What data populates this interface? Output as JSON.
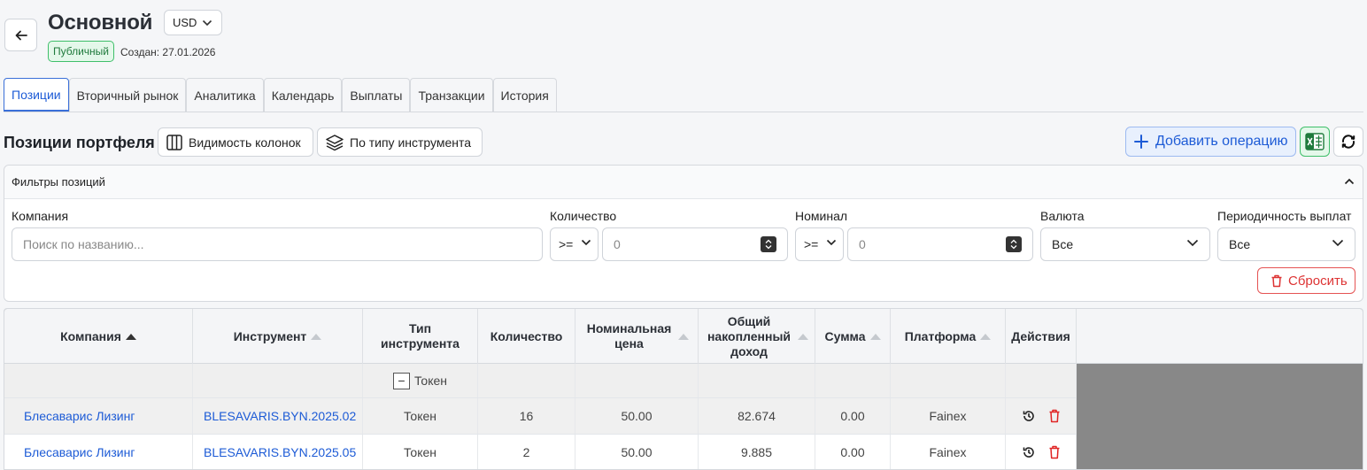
{
  "header": {
    "title": "Основной",
    "currency": "USD",
    "badge": "Публичный",
    "created": "Создан: 27.01.2026"
  },
  "tabs": [
    {
      "label": "Позиции",
      "active": true
    },
    {
      "label": "Вторичный рынок"
    },
    {
      "label": "Аналитика"
    },
    {
      "label": "Календарь"
    },
    {
      "label": "Выплаты"
    },
    {
      "label": "Транзакции"
    },
    {
      "label": "История"
    }
  ],
  "toolbar": {
    "section_title": "Позиции портфеля",
    "columns_visibility": "Видимость колонок",
    "by_type": "По типу инструмента",
    "add_operation": "Добавить операцию"
  },
  "filters": {
    "title": "Фильтры позиций",
    "company_label": "Компания",
    "company_placeholder": "Поиск по названию...",
    "quantity_label": "Количество",
    "quantity_op": ">=",
    "quantity_value": "0",
    "nominal_label": "Номинал",
    "nominal_op": ">=",
    "nominal_value": "0",
    "currency_label": "Валюта",
    "currency_value": "Все",
    "period_label": "Периодичность выплат",
    "period_value": "Все",
    "reset": "Сбросить"
  },
  "table": {
    "headers": {
      "company": "Компания",
      "instrument": "Инструмент",
      "type": "Тип инструмента",
      "quantity": "Количество",
      "nominal": "Номинальная цена",
      "income": "Общий накопленный доход",
      "sum": "Сумма",
      "platform": "Платформа",
      "actions": "Действия"
    },
    "group_label": "Токен",
    "rows": [
      {
        "company": "Блесаварис Лизинг",
        "instrument": "BLESAVARIS.BYN.2025.02",
        "type": "Токен",
        "quantity": "16",
        "nominal": "50.00",
        "income": "82.674",
        "sum": "0.00",
        "platform": "Fainex"
      },
      {
        "company": "Блесаварис Лизинг",
        "instrument": "BLESAVARIS.BYN.2025.05",
        "type": "Токен",
        "quantity": "2",
        "nominal": "50.00",
        "income": "9.885",
        "sum": "0.00",
        "platform": "Fainex"
      }
    ]
  }
}
